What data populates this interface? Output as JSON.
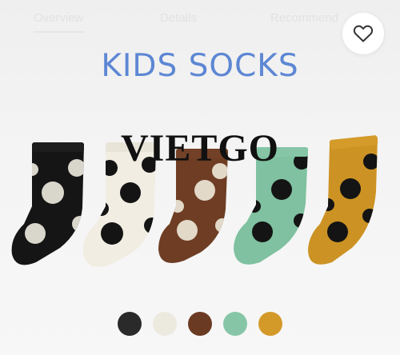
{
  "tabs": [
    "Overview",
    "Details",
    "Recommend"
  ],
  "headline": "KIDS SOCKS",
  "watermark": "VIETGO",
  "icons": {
    "favorite": "heart-icon"
  },
  "colors": {
    "headline": "#5d87d4",
    "black": "#151515",
    "cream": "#f1ede2",
    "brown": "#6e3d23",
    "mint": "#7fc1a0",
    "mustard": "#cc9324",
    "dots_light": "#d9d6cc",
    "dots_dark": "#141414"
  },
  "variants": [
    {
      "name": "black",
      "color": "#2a2a2a"
    },
    {
      "name": "cream",
      "color": "#ece9df"
    },
    {
      "name": "brown",
      "color": "#6b3a22"
    },
    {
      "name": "mint",
      "color": "#86c6a7"
    },
    {
      "name": "mustard",
      "color": "#d39a2a"
    }
  ]
}
